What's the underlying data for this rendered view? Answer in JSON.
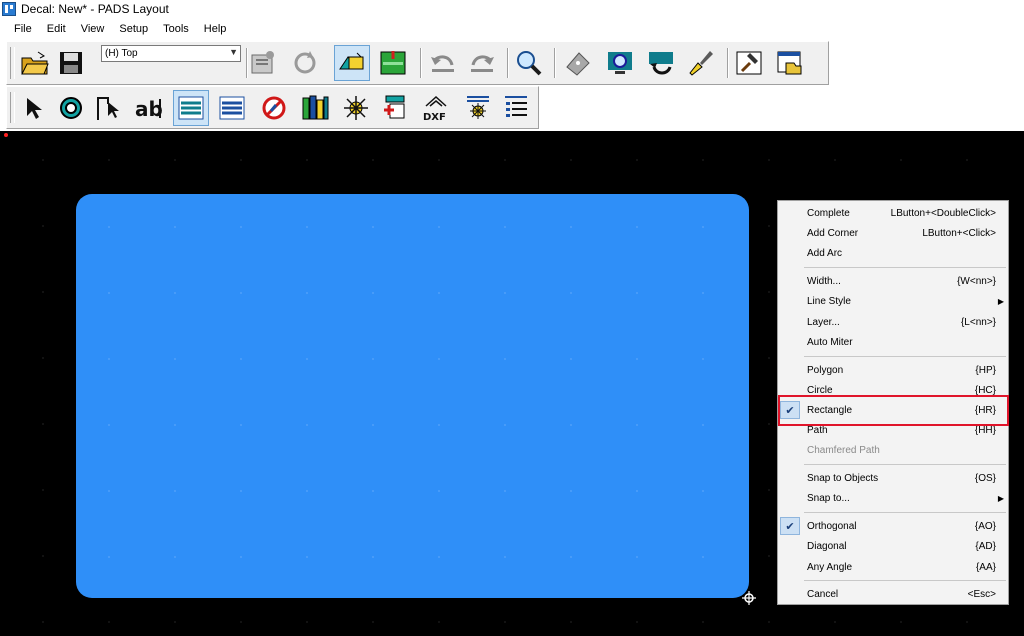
{
  "window": {
    "title": "Decal: New* - PADS Layout"
  },
  "menubar": {
    "items": [
      "File",
      "Edit",
      "View",
      "Setup",
      "Tools",
      "Help"
    ]
  },
  "toolbar": {
    "layer_select_value": "(H) Top"
  },
  "context_menu": {
    "items": [
      {
        "label": "Complete",
        "shortcut": "LButton+<DoubleClick>"
      },
      {
        "label": "Add Corner",
        "shortcut": "LButton+<Click>"
      },
      {
        "label": "Add Arc",
        "shortcut": ""
      },
      {
        "label": "Width...",
        "shortcut": "{W<nn>}"
      },
      {
        "label": "Line Style",
        "shortcut": ""
      },
      {
        "label": "Layer...",
        "shortcut": "{L<nn>}"
      },
      {
        "label": "Auto Miter",
        "shortcut": ""
      },
      {
        "label": "Polygon",
        "shortcut": "{HP}"
      },
      {
        "label": "Circle",
        "shortcut": "{HC}"
      },
      {
        "label": "Rectangle",
        "shortcut": "{HR}"
      },
      {
        "label": "Path",
        "shortcut": "{HH}"
      },
      {
        "label": "Chamfered Path",
        "shortcut": ""
      },
      {
        "label": "Snap to Objects",
        "shortcut": "{OS}"
      },
      {
        "label": "Snap to...",
        "shortcut": ""
      },
      {
        "label": "Orthogonal",
        "shortcut": "{AO}"
      },
      {
        "label": "Diagonal",
        "shortcut": "{AD}"
      },
      {
        "label": "Any Angle",
        "shortcut": "{AA}"
      },
      {
        "label": "Cancel",
        "shortcut": "<Esc>"
      }
    ]
  },
  "colors": {
    "canvas": "#000000",
    "shape_fill": "#2f8ff8",
    "highlight": "#e0142a"
  }
}
